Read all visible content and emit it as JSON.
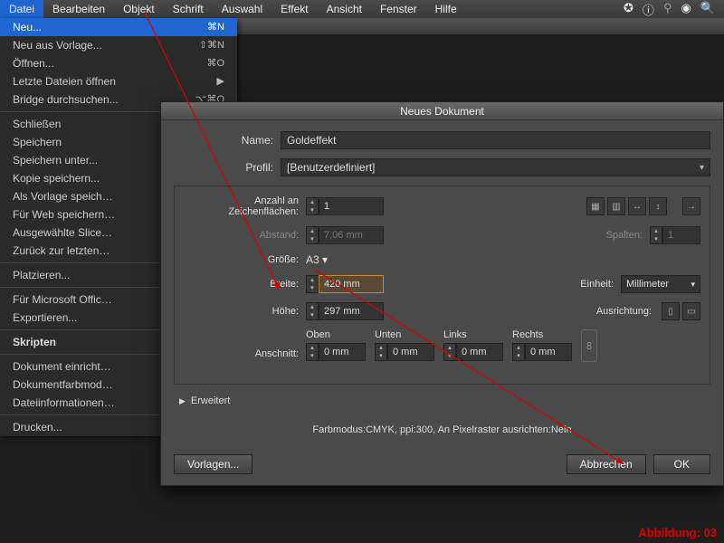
{
  "menu": {
    "items": [
      "Datei",
      "Bearbeiten",
      "Objekt",
      "Schrift",
      "Auswahl",
      "Effekt",
      "Ansicht",
      "Fenster",
      "Hilfe"
    ],
    "status_icons": [
      "notify-icon",
      "info-icon",
      "bluetooth-icon",
      "wifi-icon",
      "search-icon"
    ]
  },
  "dropdown": {
    "sections": [
      [
        {
          "label": "Neu...",
          "shortcut": "⌘N",
          "highlight": true
        },
        {
          "label": "Neu aus Vorlage...",
          "shortcut": "⇧⌘N"
        },
        {
          "label": "Öffnen...",
          "shortcut": "⌘O"
        },
        {
          "label": "Letzte Dateien öffnen",
          "shortcut": "▶"
        },
        {
          "label": "Bridge durchsuchen...",
          "shortcut": "⌥⌘O"
        }
      ],
      [
        {
          "label": "Schließen"
        },
        {
          "label": "Speichern"
        },
        {
          "label": "Speichern unter..."
        },
        {
          "label": "Kopie speichern..."
        },
        {
          "label": "Als Vorlage speich…"
        },
        {
          "label": "Für Web speichern…"
        },
        {
          "label": "Ausgewählte Slice…"
        },
        {
          "label": "Zurück zur letzten…"
        }
      ],
      [
        {
          "label": "Platzieren..."
        }
      ],
      [
        {
          "label": "Für Microsoft Offic…"
        },
        {
          "label": "Exportieren..."
        }
      ],
      [
        {
          "label": "Skripten",
          "bold": true
        }
      ],
      [
        {
          "label": "Dokument einricht…"
        },
        {
          "label": "Dokumentfarbmod…"
        },
        {
          "label": "Dateiinformationen…"
        }
      ],
      [
        {
          "label": "Drucken..."
        }
      ]
    ]
  },
  "dialog": {
    "title": "Neues Dokument",
    "name_label": "Name:",
    "name_value": "Goldeffekt",
    "profile_label": "Profil:",
    "profile_value": "[Benutzerdefiniert]",
    "artboards_label": "Anzahl an Zeichenflächen:",
    "artboards_value": "1",
    "spacing_label": "Abstand:",
    "spacing_value": "7,06 mm",
    "columns_label": "Spalten:",
    "columns_value": "1",
    "size_label": "Größe:",
    "size_value": "A3",
    "width_label": "Breite:",
    "width_value": "420 mm",
    "unit_label": "Einheit:",
    "unit_value": "Millimeter",
    "height_label": "Höhe:",
    "height_value": "297 mm",
    "orient_label": "Ausrichtung:",
    "bleed_label": "Anschnitt:",
    "bleed": {
      "top": "Oben",
      "bottom": "Unten",
      "left": "Links",
      "right": "Rechts",
      "val": "0 mm"
    },
    "advanced_label": "Erweitert",
    "summary": "Farbmodus:CMYK, ppi:300, An Pixelraster ausrichten:Nein",
    "buttons": {
      "templates": "Vorlagen...",
      "cancel": "Abbrechen",
      "ok": "OK"
    }
  },
  "figure_label": "Abbildung: 03"
}
